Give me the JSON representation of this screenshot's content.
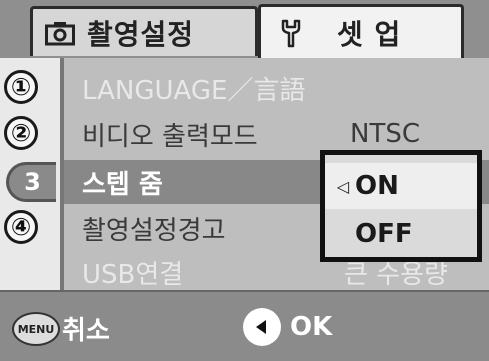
{
  "tabs": [
    {
      "label": "촬영설정",
      "icon": "camera-icon"
    },
    {
      "label": "셋 업",
      "icon": "wrench-icon"
    }
  ],
  "page_numbers": [
    "①",
    "②",
    "3",
    "④"
  ],
  "menu_items": [
    {
      "label": "LANGUAGE／言語",
      "value": ""
    },
    {
      "label": "비디오 출력모드",
      "value": "NTSC"
    },
    {
      "label": "스텝 줌",
      "value": ""
    },
    {
      "label": "촬영설정경고",
      "value": ""
    },
    {
      "label": "USB연결",
      "value": "큰 수용량"
    }
  ],
  "popup": {
    "options": [
      "ON",
      "OFF"
    ],
    "selected": "ON",
    "marker": "◁"
  },
  "bottom_bar": {
    "menu_key": "MENU",
    "cancel_label": "취소",
    "ok_label": "OK"
  },
  "colors": {
    "tabbar": "#8f8f8f",
    "menu_bg": "#bebebe",
    "active_row": "#888888",
    "popup_border": "#111111"
  }
}
